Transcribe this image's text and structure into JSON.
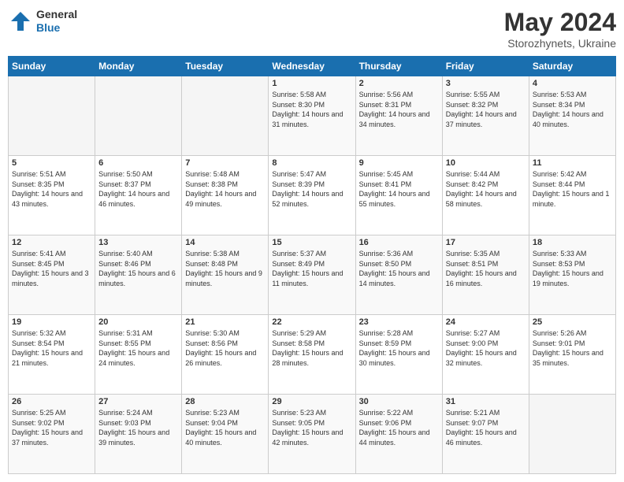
{
  "header": {
    "logo": {
      "general": "General",
      "blue": "Blue"
    },
    "title": "May 2024",
    "subtitle": "Storozhynets, Ukraine"
  },
  "weekdays": [
    "Sunday",
    "Monday",
    "Tuesday",
    "Wednesday",
    "Thursday",
    "Friday",
    "Saturday"
  ],
  "weeks": [
    [
      {
        "day": "",
        "sunrise": "",
        "sunset": "",
        "daylight": ""
      },
      {
        "day": "",
        "sunrise": "",
        "sunset": "",
        "daylight": ""
      },
      {
        "day": "",
        "sunrise": "",
        "sunset": "",
        "daylight": ""
      },
      {
        "day": "1",
        "sunrise": "Sunrise: 5:58 AM",
        "sunset": "Sunset: 8:30 PM",
        "daylight": "Daylight: 14 hours and 31 minutes."
      },
      {
        "day": "2",
        "sunrise": "Sunrise: 5:56 AM",
        "sunset": "Sunset: 8:31 PM",
        "daylight": "Daylight: 14 hours and 34 minutes."
      },
      {
        "day": "3",
        "sunrise": "Sunrise: 5:55 AM",
        "sunset": "Sunset: 8:32 PM",
        "daylight": "Daylight: 14 hours and 37 minutes."
      },
      {
        "day": "4",
        "sunrise": "Sunrise: 5:53 AM",
        "sunset": "Sunset: 8:34 PM",
        "daylight": "Daylight: 14 hours and 40 minutes."
      }
    ],
    [
      {
        "day": "5",
        "sunrise": "Sunrise: 5:51 AM",
        "sunset": "Sunset: 8:35 PM",
        "daylight": "Daylight: 14 hours and 43 minutes."
      },
      {
        "day": "6",
        "sunrise": "Sunrise: 5:50 AM",
        "sunset": "Sunset: 8:37 PM",
        "daylight": "Daylight: 14 hours and 46 minutes."
      },
      {
        "day": "7",
        "sunrise": "Sunrise: 5:48 AM",
        "sunset": "Sunset: 8:38 PM",
        "daylight": "Daylight: 14 hours and 49 minutes."
      },
      {
        "day": "8",
        "sunrise": "Sunrise: 5:47 AM",
        "sunset": "Sunset: 8:39 PM",
        "daylight": "Daylight: 14 hours and 52 minutes."
      },
      {
        "day": "9",
        "sunrise": "Sunrise: 5:45 AM",
        "sunset": "Sunset: 8:41 PM",
        "daylight": "Daylight: 14 hours and 55 minutes."
      },
      {
        "day": "10",
        "sunrise": "Sunrise: 5:44 AM",
        "sunset": "Sunset: 8:42 PM",
        "daylight": "Daylight: 14 hours and 58 minutes."
      },
      {
        "day": "11",
        "sunrise": "Sunrise: 5:42 AM",
        "sunset": "Sunset: 8:44 PM",
        "daylight": "Daylight: 15 hours and 1 minute."
      }
    ],
    [
      {
        "day": "12",
        "sunrise": "Sunrise: 5:41 AM",
        "sunset": "Sunset: 8:45 PM",
        "daylight": "Daylight: 15 hours and 3 minutes."
      },
      {
        "day": "13",
        "sunrise": "Sunrise: 5:40 AM",
        "sunset": "Sunset: 8:46 PM",
        "daylight": "Daylight: 15 hours and 6 minutes."
      },
      {
        "day": "14",
        "sunrise": "Sunrise: 5:38 AM",
        "sunset": "Sunset: 8:48 PM",
        "daylight": "Daylight: 15 hours and 9 minutes."
      },
      {
        "day": "15",
        "sunrise": "Sunrise: 5:37 AM",
        "sunset": "Sunset: 8:49 PM",
        "daylight": "Daylight: 15 hours and 11 minutes."
      },
      {
        "day": "16",
        "sunrise": "Sunrise: 5:36 AM",
        "sunset": "Sunset: 8:50 PM",
        "daylight": "Daylight: 15 hours and 14 minutes."
      },
      {
        "day": "17",
        "sunrise": "Sunrise: 5:35 AM",
        "sunset": "Sunset: 8:51 PM",
        "daylight": "Daylight: 15 hours and 16 minutes."
      },
      {
        "day": "18",
        "sunrise": "Sunrise: 5:33 AM",
        "sunset": "Sunset: 8:53 PM",
        "daylight": "Daylight: 15 hours and 19 minutes."
      }
    ],
    [
      {
        "day": "19",
        "sunrise": "Sunrise: 5:32 AM",
        "sunset": "Sunset: 8:54 PM",
        "daylight": "Daylight: 15 hours and 21 minutes."
      },
      {
        "day": "20",
        "sunrise": "Sunrise: 5:31 AM",
        "sunset": "Sunset: 8:55 PM",
        "daylight": "Daylight: 15 hours and 24 minutes."
      },
      {
        "day": "21",
        "sunrise": "Sunrise: 5:30 AM",
        "sunset": "Sunset: 8:56 PM",
        "daylight": "Daylight: 15 hours and 26 minutes."
      },
      {
        "day": "22",
        "sunrise": "Sunrise: 5:29 AM",
        "sunset": "Sunset: 8:58 PM",
        "daylight": "Daylight: 15 hours and 28 minutes."
      },
      {
        "day": "23",
        "sunrise": "Sunrise: 5:28 AM",
        "sunset": "Sunset: 8:59 PM",
        "daylight": "Daylight: 15 hours and 30 minutes."
      },
      {
        "day": "24",
        "sunrise": "Sunrise: 5:27 AM",
        "sunset": "Sunset: 9:00 PM",
        "daylight": "Daylight: 15 hours and 32 minutes."
      },
      {
        "day": "25",
        "sunrise": "Sunrise: 5:26 AM",
        "sunset": "Sunset: 9:01 PM",
        "daylight": "Daylight: 15 hours and 35 minutes."
      }
    ],
    [
      {
        "day": "26",
        "sunrise": "Sunrise: 5:25 AM",
        "sunset": "Sunset: 9:02 PM",
        "daylight": "Daylight: 15 hours and 37 minutes."
      },
      {
        "day": "27",
        "sunrise": "Sunrise: 5:24 AM",
        "sunset": "Sunset: 9:03 PM",
        "daylight": "Daylight: 15 hours and 39 minutes."
      },
      {
        "day": "28",
        "sunrise": "Sunrise: 5:23 AM",
        "sunset": "Sunset: 9:04 PM",
        "daylight": "Daylight: 15 hours and 40 minutes."
      },
      {
        "day": "29",
        "sunrise": "Sunrise: 5:23 AM",
        "sunset": "Sunset: 9:05 PM",
        "daylight": "Daylight: 15 hours and 42 minutes."
      },
      {
        "day": "30",
        "sunrise": "Sunrise: 5:22 AM",
        "sunset": "Sunset: 9:06 PM",
        "daylight": "Daylight: 15 hours and 44 minutes."
      },
      {
        "day": "31",
        "sunrise": "Sunrise: 5:21 AM",
        "sunset": "Sunset: 9:07 PM",
        "daylight": "Daylight: 15 hours and 46 minutes."
      },
      {
        "day": "",
        "sunrise": "",
        "sunset": "",
        "daylight": ""
      }
    ]
  ]
}
